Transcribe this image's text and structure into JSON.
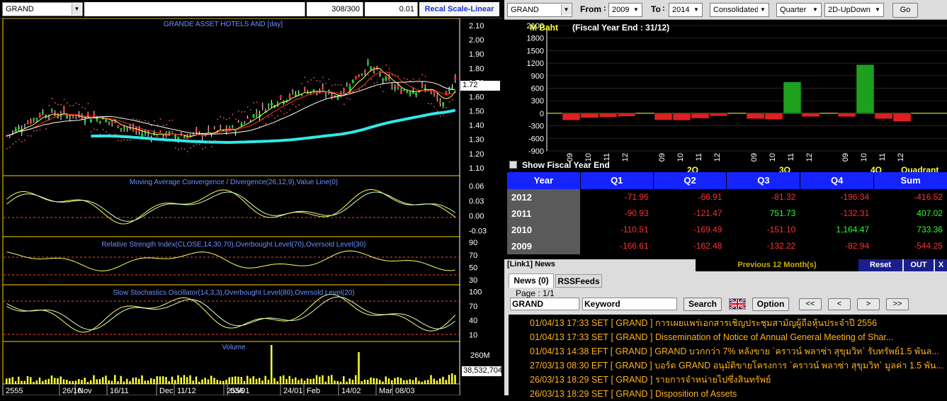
{
  "left_toolbar": {
    "symbol": "GRAND",
    "count": "308/300",
    "value": "0.01",
    "recal_label": "Recal Scale-Linear"
  },
  "price_panel": {
    "title": "GRANDE ASSET HOTELS AND [day]",
    "last_price": "1.72",
    "y_ticks": [
      "2.10",
      "2.00",
      "1.90",
      "1.80",
      "1.70",
      "1.60",
      "1.50",
      "1.40",
      "1.30",
      "1.20",
      "1.10"
    ]
  },
  "macd_panel": {
    "title": "Moving Average Convergence / Divergence(26,12,9),Value Line(0)",
    "y_ticks": [
      "0.06",
      "0.03",
      "0.00",
      "-0.03"
    ]
  },
  "rsi_panel": {
    "title": "Relative Strength Index(CLOSE,14,30,70),Overbought Level(70),Oversold Level(30)",
    "y_ticks": [
      "90",
      "70",
      "50",
      "30"
    ]
  },
  "stoch_panel": {
    "title": "Slow Stochastics Oscillator(14,3,3),Overbought Level(80),Oversold Level(20)",
    "y_ticks": [
      "100",
      "70",
      "40",
      "10"
    ]
  },
  "volume_panel": {
    "title": "Volume",
    "y_tick": "260M",
    "last_volume": "38,532,704"
  },
  "x_axis": {
    "labels": [
      "2555",
      "26/10",
      "Nov",
      "16/11",
      "Dec",
      "11/12",
      "2556",
      "03/01",
      "24/01",
      "Feb",
      "14/02",
      "Mar",
      "08/03"
    ]
  },
  "right_toolbar": {
    "symbol": "GRAND",
    "from_label": "From",
    "from_year": "2009",
    "to_label": "To",
    "to_year": "2014",
    "type": "Consolidated",
    "period": "Quarter",
    "chart_style": "2D-UpDown",
    "go_label": "Go"
  },
  "fin_chart": {
    "unit": "M Baht",
    "subtitle": "(Fiscal Year End : 31/12)",
    "y_ticks": [
      "2100",
      "1800",
      "1500",
      "1200",
      "900",
      "600",
      "300",
      "0",
      "-300",
      "-600",
      "-900"
    ],
    "x_tick_labels": [
      "09",
      "10",
      "11",
      "12",
      "09",
      "10",
      "11",
      "12",
      "09",
      "10",
      "11",
      "12",
      "09",
      "10",
      "11",
      "12"
    ],
    "quarter_labels": [
      "2Q",
      "3Q",
      "4Q"
    ],
    "x_axis_title": "Quadrant",
    "show_fiscal_label": "Show Fiscal Year End"
  },
  "chart_data": {
    "type": "bar",
    "title": "M Baht",
    "ylim": [
      -900,
      2100
    ],
    "quarters": [
      "Q1",
      "Q2",
      "Q3",
      "Q4"
    ],
    "years": [
      "2009",
      "2010",
      "2011",
      "2012"
    ],
    "series": [
      {
        "name": "Q1",
        "values": [
          -166.61,
          -110.51,
          -90.93,
          -71.96
        ]
      },
      {
        "name": "Q2",
        "values": [
          -162.48,
          -169.49,
          -121.47,
          -66.91
        ]
      },
      {
        "name": "Q3",
        "values": [
          -132.22,
          -151.1,
          751.73,
          -81.32
        ]
      },
      {
        "name": "Q4",
        "values": [
          -82.94,
          1164.47,
          -132.31,
          -196.34
        ]
      }
    ]
  },
  "fin_table": {
    "headers": [
      "Year",
      "Q1",
      "Q2",
      "Q3",
      "Q4",
      "Sum"
    ],
    "rows": [
      {
        "year": "2012",
        "vals": [
          "-71.96",
          "-66.91",
          "-81.32",
          "-196.34",
          "-416.52"
        ]
      },
      {
        "year": "2011",
        "vals": [
          "-90.93",
          "-121.47",
          "751.73",
          "-132.31",
          "407.02"
        ]
      },
      {
        "year": "2010",
        "vals": [
          "-110.51",
          "-169.49",
          "-151.10",
          "1,164.47",
          "733.36"
        ]
      },
      {
        "year": "2009",
        "vals": [
          "-166.61",
          "-162.48",
          "-132.22",
          "-82.94",
          "-544.25"
        ]
      }
    ]
  },
  "news": {
    "title": "[Link1] News",
    "period": "Previous 12 Month(s)",
    "reset_label": "Reset",
    "out_label": "OUT",
    "close_label": "X",
    "tab_news": "News (0)",
    "tab_rss": "RSSFeeds",
    "page": "Page : 1/1",
    "symbol": "GRAND",
    "keyword": "Keyword",
    "search_label": "Search",
    "option_label": "Option",
    "nav": [
      "<<",
      "<",
      ">",
      ">>"
    ],
    "items": [
      {
        "date": "01/04/13 17:33",
        "src": "SET",
        "sym": "[ GRAND ]",
        "text": "การเผยแพร่เอกสารเชิญประชุมสามัญผู้ถือหุ้นประจำปี 2556"
      },
      {
        "date": "01/04/13 17:33",
        "src": "SET",
        "sym": "[ GRAND ]",
        "text": "Dissemination of Notice of Annual General Meeting of Shar..."
      },
      {
        "date": "01/04/13 14:38",
        "src": "EFT",
        "sym": "[ GRAND ]",
        "text": "GRAND บวกกว่า 7% หลังขาย `คราวน์ พลาซ่า สุขุมวิท` รับทรัพย์1.5 พันล..."
      },
      {
        "date": "27/03/13 08:30",
        "src": "EFT",
        "sym": "[ GRAND ]",
        "text": "บอร์ด GRAND อนุมัติขายโครงการ `คราวน์ พลาซ่า สุขุมวิท` มูลค่า 1.5 พัน..."
      },
      {
        "date": "26/03/13 18:29",
        "src": "SET",
        "sym": "[ GRAND ]",
        "text": "รายการจำหน่ายไปซึ่งสินทรัพย์"
      },
      {
        "date": "26/03/13 18:29",
        "src": "SET",
        "sym": "[ GRAND ]",
        "text": "Disposition of Assets"
      }
    ]
  },
  "colors": {
    "up": "#00e000",
    "down": "#ff2020",
    "macd": "#ffff40",
    "signal": "#e0ffe0",
    "table_header": "#1524ff",
    "news_text": "#ffb21e"
  }
}
